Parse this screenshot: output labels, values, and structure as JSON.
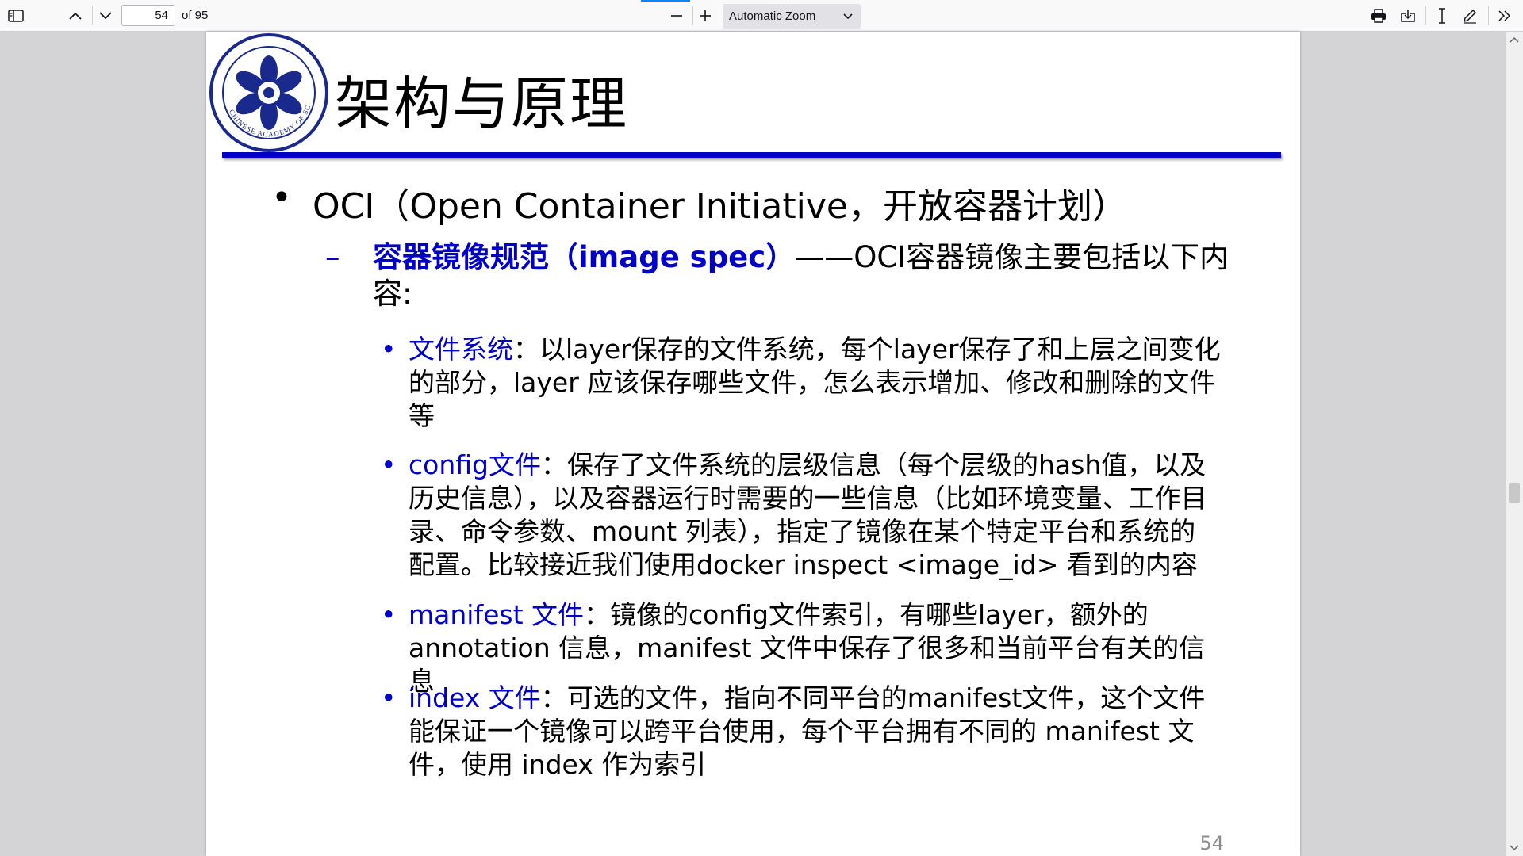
{
  "toolbar": {
    "page_number": "54",
    "page_count_label": "of 95",
    "zoom_label": "Automatic Zoom"
  },
  "slide": {
    "title": "架构与原理",
    "logo_text": "CHINESE ACADEMY OF SCIENCES",
    "level1": "OCI（Open Container Initiative，开放容器计划）",
    "level2_highlight": "容器镜像规范（image spec）",
    "level2_rest": "——OCI容器镜像主要包括以下内容:",
    "items": [
      {
        "highlight": "文件系统",
        "text": "：以layer保存的文件系统，每个layer保存了和上层之间变化的部分，layer 应该保存哪些文件，怎么表示增加、修改和删除的文件等"
      },
      {
        "highlight": "config文件",
        "text": "：保存了文件系统的层级信息（每个层级的hash值，以及历史信息），以及容器运行时需要的一些信息（比如环境变量、工作目录、命令参数、mount 列表），指定了镜像在某个特定平台和系统的配置。比较接近我们使用docker inspect <image_id> 看到的内容"
      },
      {
        "highlight": "manifest 文件",
        "text": "：镜像的config文件索引，有哪些layer，额外的annotation 信息，manifest 文件中保存了很多和当前平台有关的信息"
      },
      {
        "highlight": "index 文件",
        "text": "：可选的文件，指向不同平台的manifest文件，这个文件能保证一个镜像可以跨平台使用，每个平台拥有不同的 manifest 文件，使用 index 作为索引"
      }
    ],
    "page_number": "54"
  },
  "colors": {
    "accent_blue": "#0000c8",
    "toolbar_bg": "#f9f9fa"
  },
  "icons": [
    "sidebar-toggle-icon",
    "chevron-up-icon",
    "chevron-down-icon",
    "zoom-out-icon",
    "zoom-in-icon",
    "print-icon",
    "save-icon",
    "text-cursor-icon",
    "draw-icon",
    "tools-menu-icon"
  ]
}
